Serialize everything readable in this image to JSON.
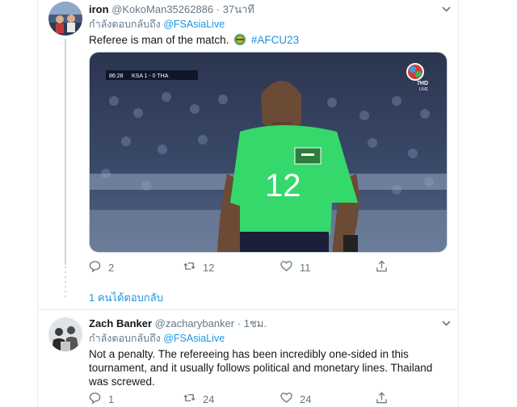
{
  "tweet1": {
    "name": "iron",
    "handle": "@KokoMan35262886",
    "separator": "·",
    "time": "37นาที",
    "reply_prefix": "กำลังตอบกลับถึง",
    "reply_to": "@FSAsiaLive",
    "text": "Referee is man of the match.",
    "hashtag": "#AFCU23",
    "media": {
      "scorebug_time": "86:28",
      "scorebug_score": "KSA 1 - 0 THA",
      "channel": "7HD",
      "channel_sub": "LIVE",
      "jersey_number": "12"
    },
    "actions": {
      "replies": "2",
      "retweets": "12",
      "likes": "11"
    }
  },
  "show_replies_label": "1 คนได้ตอบกลับ",
  "tweet2": {
    "name": "Zach Banker",
    "handle": "@zacharybanker",
    "separator": "·",
    "time": "1ชม.",
    "reply_prefix": "กำลังตอบกลับถึง",
    "reply_to": "@FSAsiaLive",
    "text": "Not a penalty. The refereeing has been incredibly one-sided in this tournament, and it usually follows political and monetary lines. Thailand was screwed.",
    "actions": {
      "replies": "1",
      "retweets": "24",
      "likes": "24"
    }
  },
  "colors": {
    "link": "#1b95e0",
    "secondary_text": "#657786",
    "border": "#e6ecf0",
    "jersey": "#35d96b"
  }
}
